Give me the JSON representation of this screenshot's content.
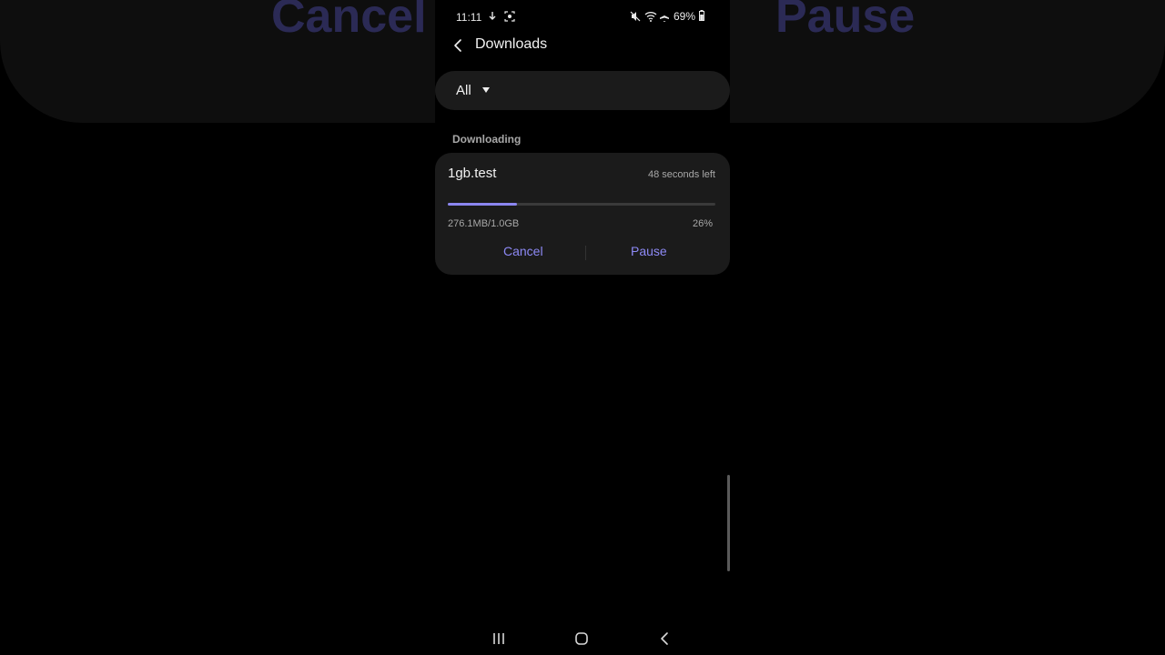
{
  "background": {
    "echo_cancel": "Cancel",
    "echo_pause": "Pause"
  },
  "status_bar": {
    "time": "11:11",
    "battery": "69%",
    "left_icons": [
      "download-icon",
      "screenshot-icon"
    ],
    "right_icons": [
      "mute-icon",
      "wifi-icon",
      "airplane-icon",
      "battery-icon"
    ]
  },
  "header": {
    "title": "Downloads"
  },
  "filter": {
    "selected": "All"
  },
  "section": {
    "label": "Downloading"
  },
  "download": {
    "file_name": "1gb.test",
    "time_left": "48 seconds left",
    "size": "276.1MB/1.0GB",
    "percent_label": "26%",
    "progress": 0.26,
    "cancel_label": "Cancel",
    "pause_label": "Pause"
  },
  "colors": {
    "accent": "#8d89f5",
    "card": "#1b1b1b",
    "background": "#000000"
  }
}
